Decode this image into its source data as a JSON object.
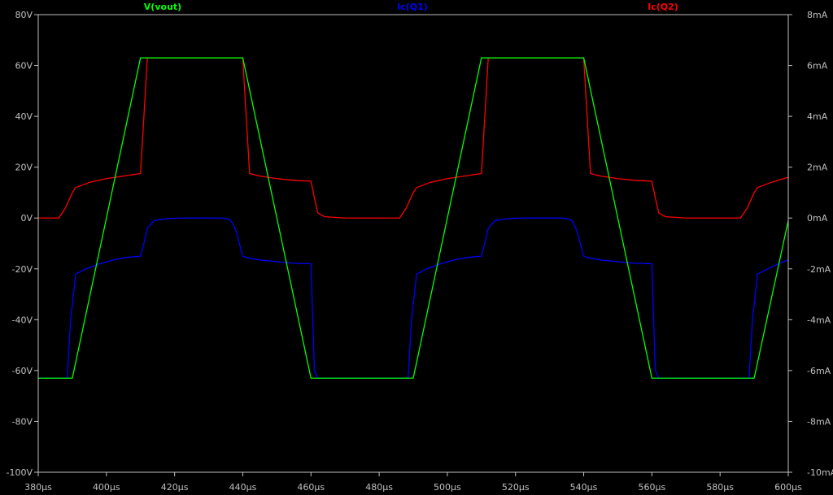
{
  "colors": {
    "background": "#000000",
    "axis": "#c0c0c0",
    "vout": "#00ff00",
    "icq1": "#0000ff",
    "icq2": "#ff0000"
  },
  "chart_data": {
    "type": "line",
    "title": "",
    "xlabel": "",
    "ylabel_left": "",
    "ylabel_right": "",
    "xlim": [
      380,
      600
    ],
    "ylim_left": [
      -100,
      80
    ],
    "ylim_right": [
      -10,
      8
    ],
    "grid": false,
    "x_ticks": [
      {
        "value": 380,
        "label": "380µs"
      },
      {
        "value": 400,
        "label": "400µs"
      },
      {
        "value": 420,
        "label": "420µs"
      },
      {
        "value": 440,
        "label": "440µs"
      },
      {
        "value": 460,
        "label": "460µs"
      },
      {
        "value": 480,
        "label": "480µs"
      },
      {
        "value": 500,
        "label": "500µs"
      },
      {
        "value": 520,
        "label": "520µs"
      },
      {
        "value": 540,
        "label": "540µs"
      },
      {
        "value": 560,
        "label": "560µs"
      },
      {
        "value": 580,
        "label": "580µs"
      },
      {
        "value": 600,
        "label": "600µs"
      }
    ],
    "y_ticks_left": [
      {
        "value": 80,
        "label": "80V"
      },
      {
        "value": 60,
        "label": "60V"
      },
      {
        "value": 40,
        "label": "40V"
      },
      {
        "value": 20,
        "label": "20V"
      },
      {
        "value": 0,
        "label": "0V"
      },
      {
        "value": -20,
        "label": "-20V"
      },
      {
        "value": -40,
        "label": "-40V"
      },
      {
        "value": -60,
        "label": "-60V"
      },
      {
        "value": -80,
        "label": "-80V"
      },
      {
        "value": -100,
        "label": "-100V"
      }
    ],
    "y_ticks_right": [
      {
        "value": 8,
        "label": "8mA"
      },
      {
        "value": 6,
        "label": "6mA"
      },
      {
        "value": 4,
        "label": "4mA"
      },
      {
        "value": 2,
        "label": "2mA"
      },
      {
        "value": 0,
        "label": "0mA"
      },
      {
        "value": -2,
        "label": "-2mA"
      },
      {
        "value": -4,
        "label": "-4mA"
      },
      {
        "value": -6,
        "label": "-6mA"
      },
      {
        "value": -8,
        "label": "-8mA"
      },
      {
        "value": -10,
        "label": "-10mA"
      }
    ],
    "series": [
      {
        "name": "V(vout)",
        "axis": "left",
        "color": "#00ff00",
        "x": [
          380,
          390,
          410,
          440,
          460,
          490,
          510,
          540,
          560,
          590,
          600
        ],
        "y": [
          -63,
          -63,
          63,
          63,
          -63,
          -63,
          63,
          63,
          -63,
          -63,
          -1
        ]
      },
      {
        "name": "Ic(Q1)",
        "axis": "right",
        "color": "#0000ff",
        "x": [
          380,
          388.5,
          389.5,
          391,
          394,
          398,
          402,
          406,
          410,
          411,
          412,
          414,
          418,
          422,
          426,
          430,
          434,
          436,
          437,
          438,
          439,
          440,
          441,
          445,
          450,
          455,
          460,
          461,
          462,
          470,
          480,
          488.5,
          489.5,
          491,
          494,
          498,
          502,
          506,
          510,
          511,
          512,
          514,
          518,
          522,
          526,
          530,
          534,
          536,
          537,
          538,
          539,
          540,
          541,
          545,
          550,
          555,
          560,
          561,
          562,
          570,
          580,
          588.5,
          589.5,
          591,
          594,
          598,
          600
        ],
        "y": [
          -6.3,
          -6.3,
          -4.0,
          -2.2,
          -2.0,
          -1.8,
          -1.65,
          -1.55,
          -1.5,
          -1.0,
          -0.4,
          -0.1,
          -0.02,
          0,
          0,
          0,
          0,
          -0.05,
          -0.2,
          -0.5,
          -1.0,
          -1.5,
          -1.55,
          -1.65,
          -1.72,
          -1.78,
          -1.8,
          -6.0,
          -6.3,
          -6.3,
          -6.3,
          -6.3,
          -4.0,
          -2.2,
          -2.0,
          -1.8,
          -1.65,
          -1.55,
          -1.5,
          -1.0,
          -0.4,
          -0.1,
          -0.02,
          0,
          0,
          0,
          0,
          -0.05,
          -0.2,
          -0.5,
          -1.0,
          -1.5,
          -1.55,
          -1.65,
          -1.72,
          -1.78,
          -1.8,
          -6.0,
          -6.3,
          -6.3,
          -6.3,
          -6.3,
          -4.0,
          -2.2,
          -2.0,
          -1.75,
          -1.65
        ]
      },
      {
        "name": "Ic(Q2)",
        "axis": "right",
        "color": "#ff0000",
        "x": [
          380,
          386,
          388,
          390,
          391,
          395,
          400,
          405,
          410,
          411,
          412,
          440,
          441,
          442,
          445,
          450,
          455,
          460,
          461,
          462,
          464,
          470,
          480,
          486,
          488,
          490,
          491,
          495,
          500,
          505,
          510,
          511,
          512,
          540,
          541,
          542,
          545,
          550,
          555,
          560,
          561,
          562,
          564,
          570,
          580,
          586,
          588,
          590,
          591,
          595,
          600
        ],
        "y": [
          0,
          0,
          0.4,
          1.0,
          1.2,
          1.4,
          1.55,
          1.65,
          1.75,
          4.0,
          6.3,
          6.3,
          4.0,
          1.75,
          1.65,
          1.55,
          1.48,
          1.45,
          0.8,
          0.2,
          0.05,
          0,
          0,
          0,
          0.4,
          1.0,
          1.2,
          1.4,
          1.55,
          1.65,
          1.75,
          4.0,
          6.3,
          6.3,
          4.0,
          1.75,
          1.65,
          1.55,
          1.48,
          1.45,
          0.8,
          0.2,
          0.05,
          0,
          0,
          0,
          0.4,
          1.0,
          1.2,
          1.4,
          1.6
        ]
      }
    ]
  }
}
